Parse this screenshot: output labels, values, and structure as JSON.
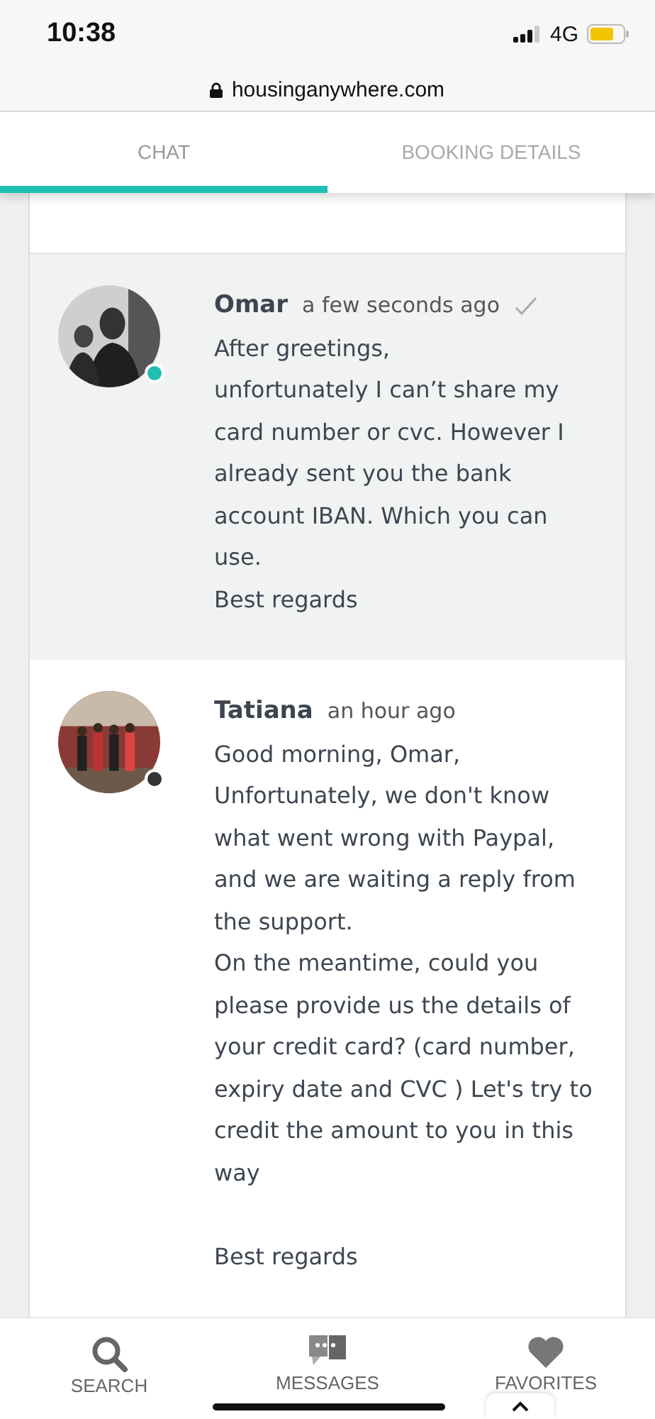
{
  "status_bar": {
    "time": "10:38",
    "network": "4G"
  },
  "browser": {
    "url": "housinganywhere.com"
  },
  "tabs": [
    {
      "label": "CHAT",
      "selected": true
    },
    {
      "label": "BOOKING DETAILS",
      "selected": false
    }
  ],
  "messages": [
    {
      "sender": "Omar",
      "time": "a few seconds ago",
      "checked": true,
      "online": true,
      "kind": "gray",
      "highlighted": true,
      "sections": [
        [
          "After greetings,",
          "unfortunately I can’t share my card number or cvc. However I already sent you the bank account IBAN. Which you can use.",
          "Best regards"
        ]
      ]
    },
    {
      "sender": "Tatiana",
      "time": "an hour ago",
      "checked": false,
      "online": false,
      "kind": "warm",
      "highlighted": false,
      "sections": [
        [
          "Good morning, Omar,",
          "Unfortunately, we don't know what went wrong with Paypal, and we are waiting a reply from the support.",
          "On the meantime, could you please provide us the details of your credit card? (card number, expiry date and CVC ) Let's try to credit the amount to you in this way"
        ],
        [
          "Best regards"
        ]
      ]
    }
  ],
  "bottom_nav": [
    {
      "label": "SEARCH",
      "kind": "search"
    },
    {
      "label": "MESSAGES",
      "kind": "messages"
    },
    {
      "label": "FAVORITES",
      "kind": "favorites"
    }
  ]
}
